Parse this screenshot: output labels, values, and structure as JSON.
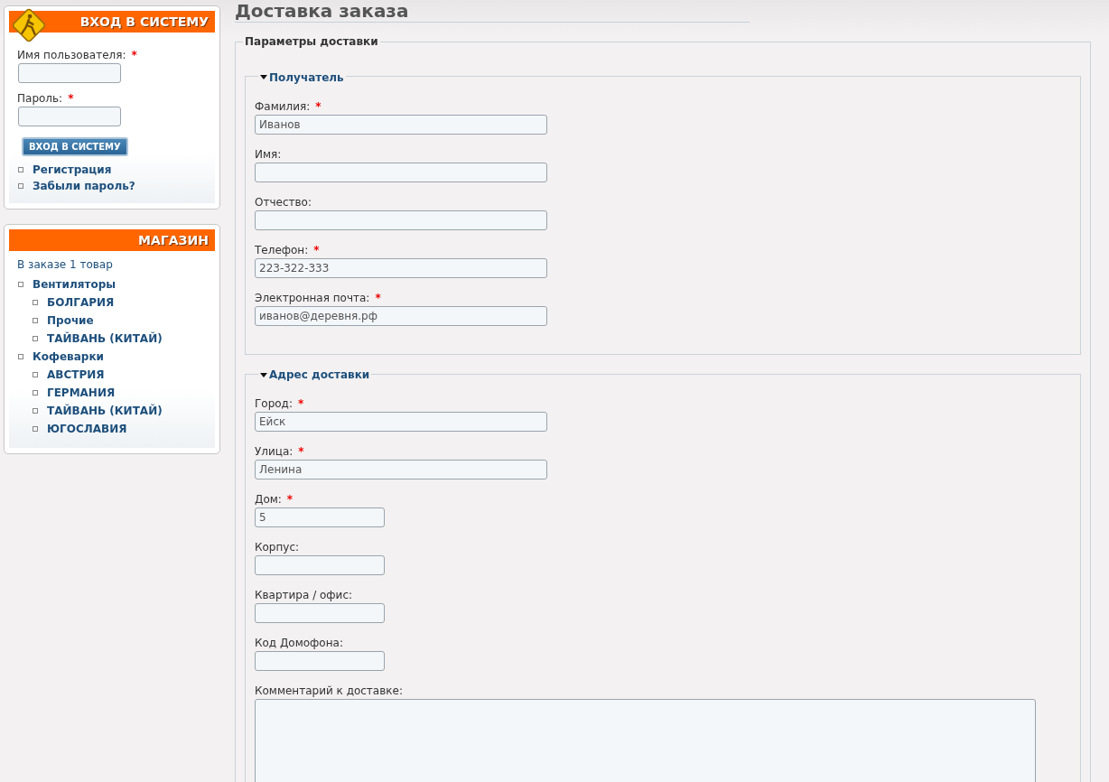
{
  "login": {
    "title": "ВХОД В СИСТЕМУ",
    "fields": [
      {
        "label": "Имя пользователя:",
        "required_mark": "*"
      },
      {
        "label": "Пароль:",
        "required_mark": "*"
      }
    ],
    "button": "ВХОД В СИСТЕМУ",
    "links": [
      "Регистрация",
      "Забыли пароль?"
    ]
  },
  "shop": {
    "title": "МАГАЗИН",
    "cart": "В заказе 1 товар",
    "categories": [
      {
        "label": "Вентиляторы",
        "children": [
          {
            "label": "БОЛГАРИЯ"
          },
          {
            "label": "Прочие"
          },
          {
            "label": "ТАЙВАНЬ (КИТАЙ)"
          }
        ]
      },
      {
        "label": "Кофеварки",
        "children": [
          {
            "label": "АВСТРИЯ"
          },
          {
            "label": "ГЕРМАНИЯ"
          },
          {
            "label": "ТАЙВАНЬ (КИТАЙ)"
          },
          {
            "label": "ЮГОСЛАВИЯ"
          }
        ]
      }
    ]
  },
  "page_title": "Доставка заказа",
  "form": {
    "legend": "Параметры доставки",
    "sections": [
      {
        "legend": "Получатель",
        "expanded": true,
        "fields": [
          {
            "label": "Фамилия:",
            "required_mark": "*",
            "value": "Иванов",
            "kind": "long"
          },
          {
            "label": "Имя:",
            "kind": "long"
          },
          {
            "label": "Отчество:",
            "kind": "long"
          },
          {
            "label": "Телефон:",
            "required_mark": "*",
            "value": "223-322-333",
            "kind": "long"
          },
          {
            "label": "Электронная почта:",
            "required_mark": "*",
            "value": "иванов@деревня.рф",
            "kind": "long"
          }
        ]
      },
      {
        "legend": "Адрес доставки",
        "expanded": true,
        "fields": [
          {
            "label": "Город:",
            "required_mark": "*",
            "value": "Ейск",
            "kind": "long"
          },
          {
            "label": "Улица:",
            "required_mark": "*",
            "value": "Ленина",
            "kind": "long"
          },
          {
            "label": "Дом:",
            "required_mark": "*",
            "value": "5",
            "kind": "short"
          },
          {
            "label": "Корпус:",
            "kind": "short"
          },
          {
            "label": "Квартира / офис:",
            "kind": "short"
          },
          {
            "label": "Код Домофона:",
            "kind": "short"
          },
          {
            "label": "Комментарий к доставке:",
            "kind": "textarea"
          }
        ]
      }
    ]
  }
}
